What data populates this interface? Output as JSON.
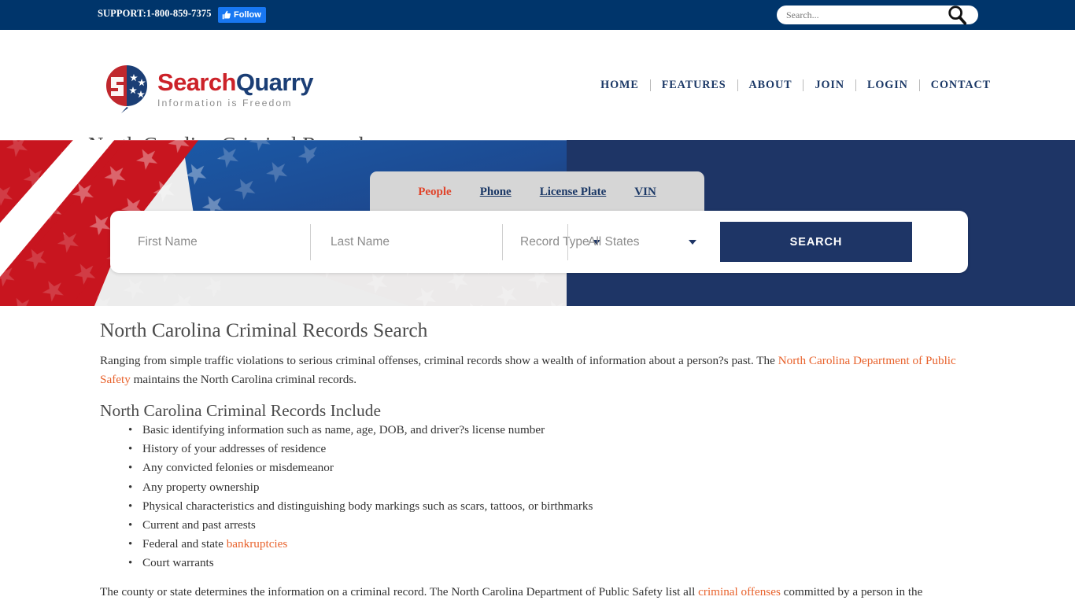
{
  "topbar": {
    "support": "SUPPORT:1-800-859-7375",
    "follow_label": "Follow",
    "follow_icon": "thumbs-up-icon",
    "search_placeholder": "Search...",
    "search_value": "",
    "search_icon": "magnifier-icon",
    "bg_color": "#00356b"
  },
  "header": {
    "logo": {
      "word_first": "Search",
      "word_second": "Quarry",
      "tagline": "Information is Freedom",
      "red": "#cc2229",
      "blue": "#1b3e75"
    },
    "nav": [
      {
        "label": "HOME"
      },
      {
        "label": "FEATURES"
      },
      {
        "label": "ABOUT"
      },
      {
        "label": "JOIN"
      },
      {
        "label": "LOGIN"
      },
      {
        "label": "CONTACT"
      }
    ],
    "page_title": "North Carolina Criminal Records"
  },
  "hero": {
    "bg_color": "#1e3566",
    "tabs": [
      {
        "label": "People",
        "active": true
      },
      {
        "label": "Phone",
        "active": false
      },
      {
        "label": "License Plate",
        "active": false
      },
      {
        "label": "VIN",
        "active": false
      }
    ],
    "form": {
      "first_name_placeholder": "First Name",
      "first_name_value": "",
      "last_name_placeholder": "Last Name",
      "last_name_value": "",
      "record_type_label": "Record Type",
      "states_label": "All States",
      "search_button": "SEARCH"
    }
  },
  "content": {
    "heading_1": "North Carolina Criminal Records Search",
    "paragraph_1": {
      "part_a": "Ranging from simple traffic violations to serious criminal offenses, criminal records show a wealth of information about a person?s past. The ",
      "link_1": "North Carolina Department of Public Safety",
      "part_b": " maintains the North Carolina criminal records."
    },
    "heading_2": "North Carolina Criminal Records Include",
    "bullets": [
      {
        "text": "Basic identifying information such as name, age, DOB, and driver?s license number"
      },
      {
        "text": "History of your addresses of residence"
      },
      {
        "text": "Any convicted felonies or misdemeanor"
      },
      {
        "text": "Any property ownership"
      },
      {
        "text": "Physical characteristics and distinguishing body markings such as scars, tattoos, or birthmarks"
      },
      {
        "text": "Current and past arrests"
      },
      {
        "text_before": "Federal and state ",
        "link": "bankruptcies",
        "text_after": ""
      },
      {
        "text": "Court warrants"
      }
    ],
    "paragraph_2": {
      "part_a": "The county or state determines the information on a criminal record. The North Carolina Department of Public Safety list all ",
      "link_1": "criminal offenses",
      "part_b": " committed by a person in the"
    },
    "link_color": "#e8622c"
  }
}
